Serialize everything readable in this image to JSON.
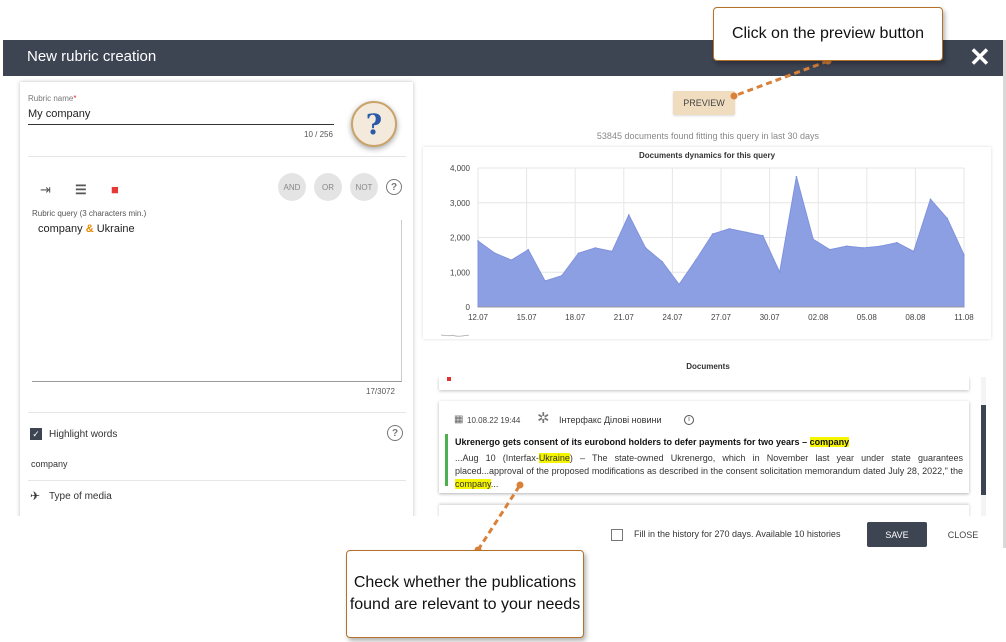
{
  "modal": {
    "title": "New rubric creation",
    "close_icon": "close-icon"
  },
  "rubric_name": {
    "label": "Rubric name",
    "required_mark": "*",
    "value": "My company",
    "counter": "10 / 256"
  },
  "help": {
    "icon": "question-mark-icon",
    "glyph": "?"
  },
  "toolbar": {
    "indent_icon": "indent-icon",
    "align_icon": "align-left-icon",
    "delete_icon": "trash-icon",
    "and_label": "AND",
    "or_label": "OR",
    "not_label": "NOT",
    "help_glyph": "?"
  },
  "rubric_query": {
    "label": "Rubric query (3 characters min.)",
    "term1": "company",
    "operator": "&",
    "term2": "Ukraine",
    "counter": "17/3072"
  },
  "highlight": {
    "label": "Highlight words",
    "checked": true,
    "help_glyph": "?",
    "value": "company"
  },
  "media": {
    "label": "Type of media",
    "icon": "satellite-dish-icon"
  },
  "preview": {
    "button_label": "PREVIEW",
    "found_text": "53845 documents found fitting this query in last 30 days"
  },
  "chart_data": {
    "type": "area",
    "title": "Documents dynamics for this query",
    "xlabel": "",
    "ylabel": "",
    "ylim": [
      0,
      4000
    ],
    "yticks": [
      "0",
      "1,000",
      "2,000",
      "3,000",
      "4,000"
    ],
    "xticks": [
      "12.07",
      "15.07",
      "18.07",
      "21.07",
      "24.07",
      "27.07",
      "30.07",
      "02.08",
      "05.08",
      "08.08",
      "11.08"
    ],
    "grid": true,
    "color": "#8d9fe3",
    "values": [
      1900,
      1550,
      1350,
      1650,
      750,
      900,
      1550,
      1700,
      1600,
      2650,
      1700,
      1300,
      650,
      1350,
      2100,
      2250,
      2150,
      2050,
      1000,
      3750,
      1950,
      1650,
      1750,
      1700,
      1750,
      1850,
      1600,
      3100,
      2550,
      1500
    ]
  },
  "documents": {
    "title": "Documents",
    "item": {
      "date": "10.08.22 19:44",
      "source": "Інтерфакс Ділові новини",
      "title_prefix": "Ukrenergo gets consent of its eurobond holders to defer payments for two years – ",
      "title_highlight": "company",
      "snip_1": "...Aug 10 (Interfax-",
      "snip_hl_1": "Ukraine",
      "snip_2": ") – The state-owned Ukrenergo, which in November last year under state guarantees placed...approval of the proposed modifications as described in the consent solicitation memorandum dated July 28, 2022,\" the ",
      "snip_hl_2": "company",
      "snip_3": "..."
    }
  },
  "footer": {
    "fill_history": "Fill in the history for 270 days. Available 10 histories",
    "save_label": "SAVE",
    "close_label": "CLOSE"
  },
  "annotations": {
    "top": "Click on the preview button",
    "bottom": "Check whether the publications found are relevant to your needs"
  }
}
